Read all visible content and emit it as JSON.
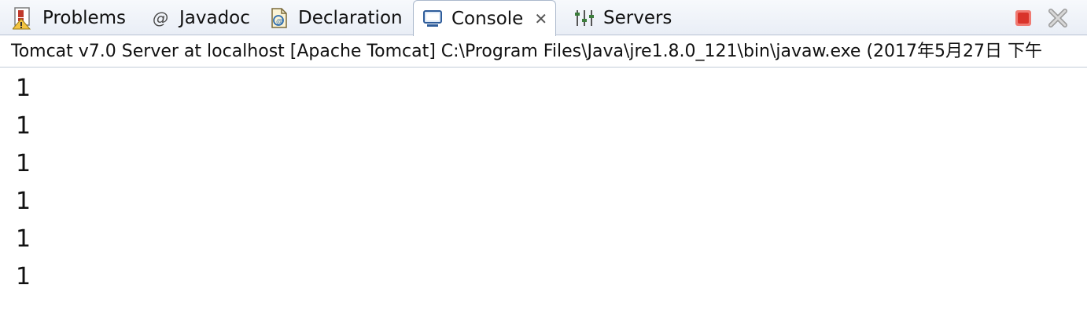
{
  "tabs": [
    {
      "label": "Problems",
      "icon": "problems-icon"
    },
    {
      "label": "Javadoc",
      "icon": "javadoc-at-icon",
      "glyph": "@"
    },
    {
      "label": "Declaration",
      "icon": "declaration-icon"
    },
    {
      "label": "Console",
      "icon": "console-icon",
      "active": true,
      "close_glyph": "✕"
    },
    {
      "label": "Servers",
      "icon": "servers-icon"
    }
  ],
  "window_controls": {
    "terminate_icon": "terminate-icon",
    "remove_all_icon": "remove-all-terminated-icon"
  },
  "colors": {
    "terminate": "#d9342b",
    "active_tab_border": "#aab8cc",
    "tab_bar_bg": "#eef2f8"
  },
  "process_info": "Tomcat v7.0 Server at localhost [Apache Tomcat] C:\\Program Files\\Java\\jre1.8.0_121\\bin\\javaw.exe (2017年5月27日 下午",
  "console_output": [
    "1",
    "1",
    "1",
    "1",
    "1",
    "1"
  ]
}
